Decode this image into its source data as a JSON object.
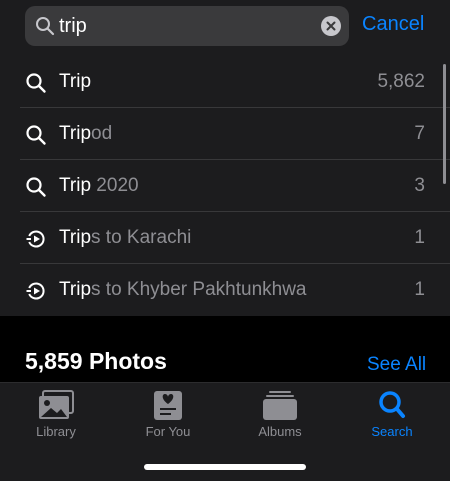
{
  "search": {
    "query": "trip",
    "cancel_label": "Cancel"
  },
  "suggestions": [
    {
      "icon": "search-icon",
      "match": "Trip",
      "rest": "",
      "count": "5,862"
    },
    {
      "icon": "search-icon",
      "match": "Trip",
      "rest": "od",
      "count": "7"
    },
    {
      "icon": "search-icon",
      "match": "Trip",
      "rest": " 2020",
      "count": "3"
    },
    {
      "icon": "memories-icon",
      "match": "Trip",
      "rest": "s to Karachi",
      "count": "1"
    },
    {
      "icon": "memories-icon",
      "match": "Trip",
      "rest": "s to Khyber Pakhtunkhwa",
      "count": "1"
    }
  ],
  "photos_section": {
    "title": "5,859 Photos",
    "see_all_label": "See All"
  },
  "tabbar": {
    "tabs": [
      {
        "label": "Library",
        "icon": "library-icon"
      },
      {
        "label": "For You",
        "icon": "for-you-icon"
      },
      {
        "label": "Albums",
        "icon": "albums-icon"
      },
      {
        "label": "Search",
        "icon": "search-icon",
        "active": true
      }
    ]
  },
  "colors": {
    "accent": "#0a84ff",
    "background": "#000000",
    "surface": "#1c1c1e"
  }
}
